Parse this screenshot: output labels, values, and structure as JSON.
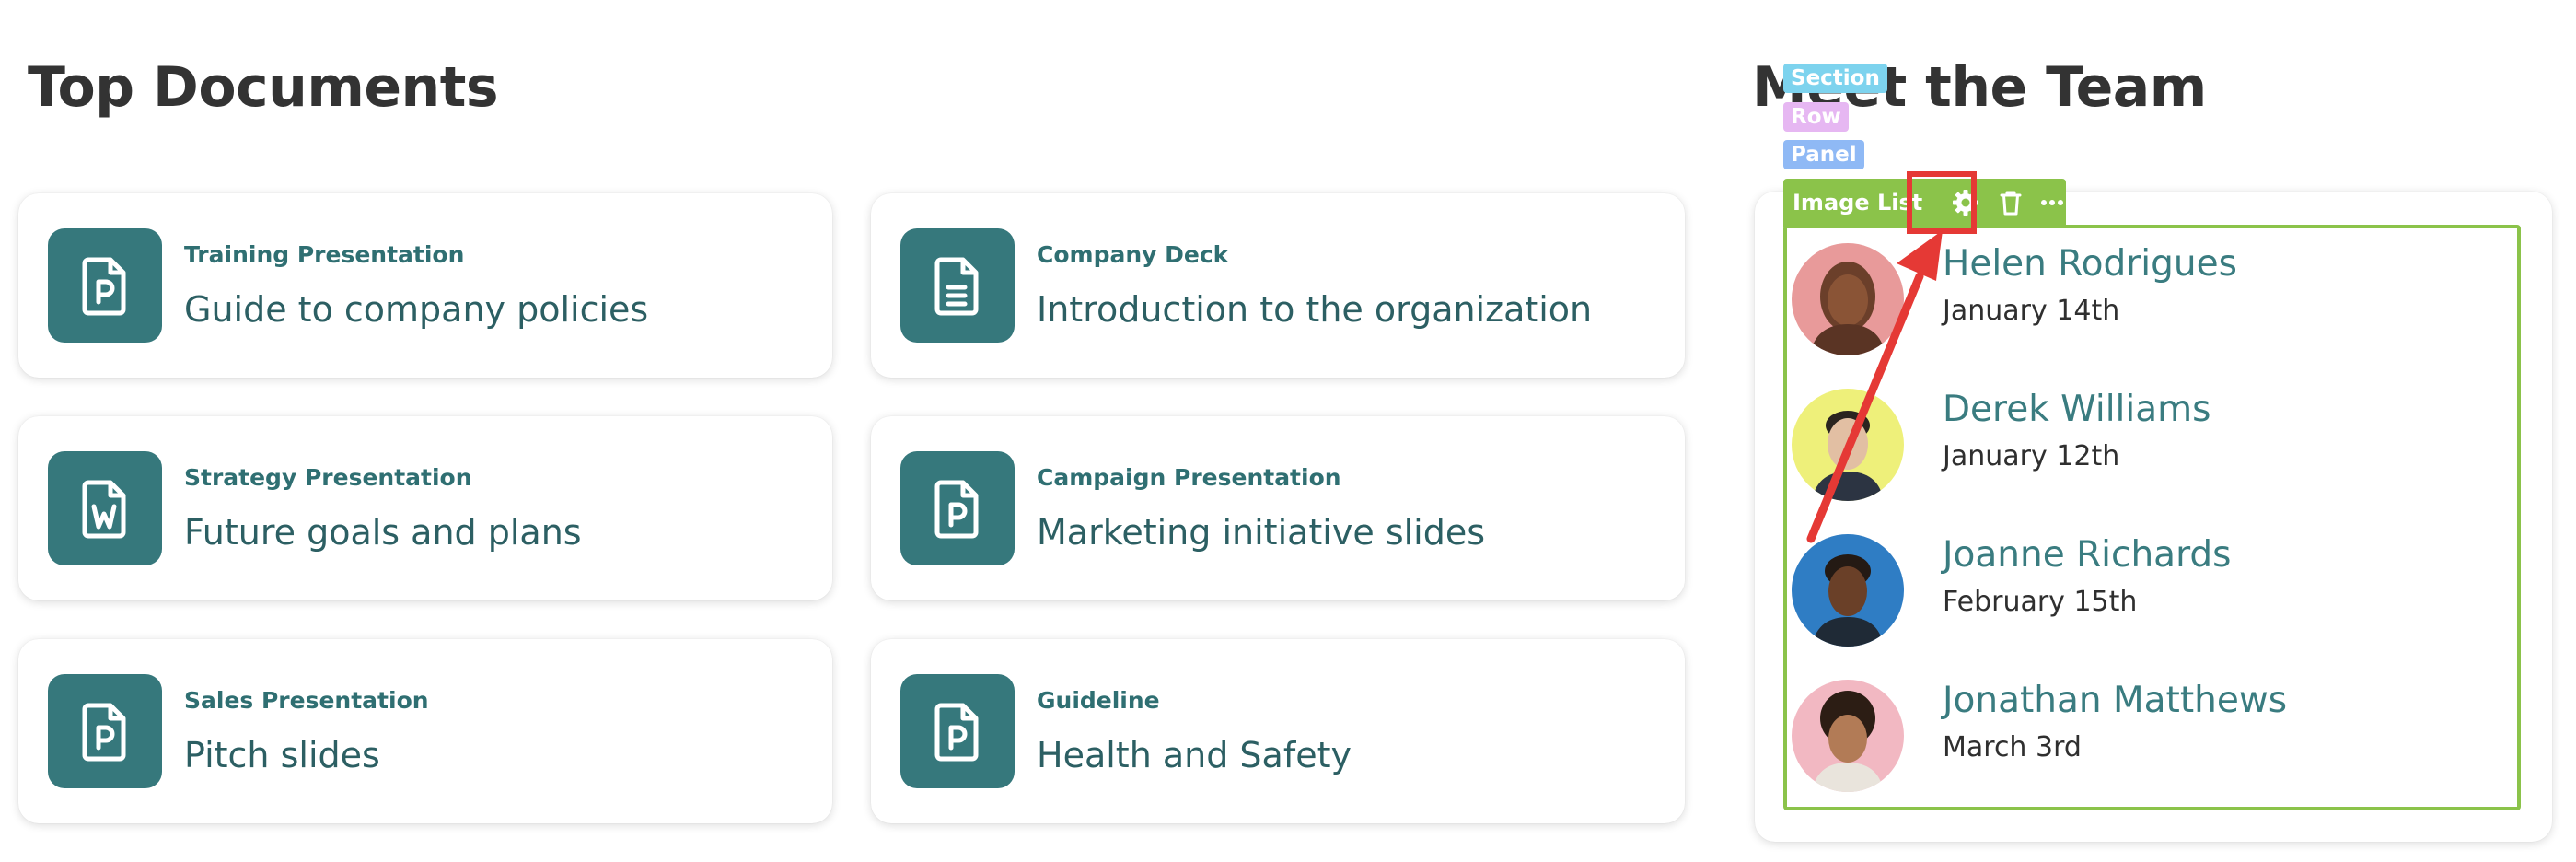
{
  "documents": {
    "heading": "Top Documents",
    "items": [
      {
        "category": "Training Presentation",
        "title": "Guide to company policies",
        "icon": "presentation-file-icon"
      },
      {
        "category": "Company Deck",
        "title": "Introduction to the organization",
        "icon": "text-document-icon"
      },
      {
        "category": "Strategy Presentation",
        "title": "Future goals and plans",
        "icon": "word-file-icon"
      },
      {
        "category": "Campaign Presentation",
        "title": "Marketing initiative slides",
        "icon": "presentation-file-icon"
      },
      {
        "category": "Sales Presentation",
        "title": "Pitch slides",
        "icon": "presentation-file-icon"
      },
      {
        "category": "Guideline",
        "title": "Health and Safety",
        "icon": "presentation-file-icon"
      }
    ]
  },
  "team": {
    "heading": "Meet the Team",
    "members": [
      {
        "name": "Helen Rodrigues",
        "date": "January 14th"
      },
      {
        "name": "Derek Williams",
        "date": "January 12th"
      },
      {
        "name": "Joanne Richards",
        "date": "February 15th"
      },
      {
        "name": "Jonathan Matthews",
        "date": "March 3rd"
      }
    ]
  },
  "editor": {
    "tags": {
      "section": "Section",
      "row": "Row",
      "panel": "Panel"
    },
    "toolbar": {
      "label": "Image List",
      "buttons": [
        "gear-icon",
        "trash-icon",
        "more-horizontal-icon"
      ]
    }
  },
  "colors": {
    "brand_teal": "#36787c",
    "editor_green": "#8bc34a",
    "highlight_red": "#e53935"
  }
}
